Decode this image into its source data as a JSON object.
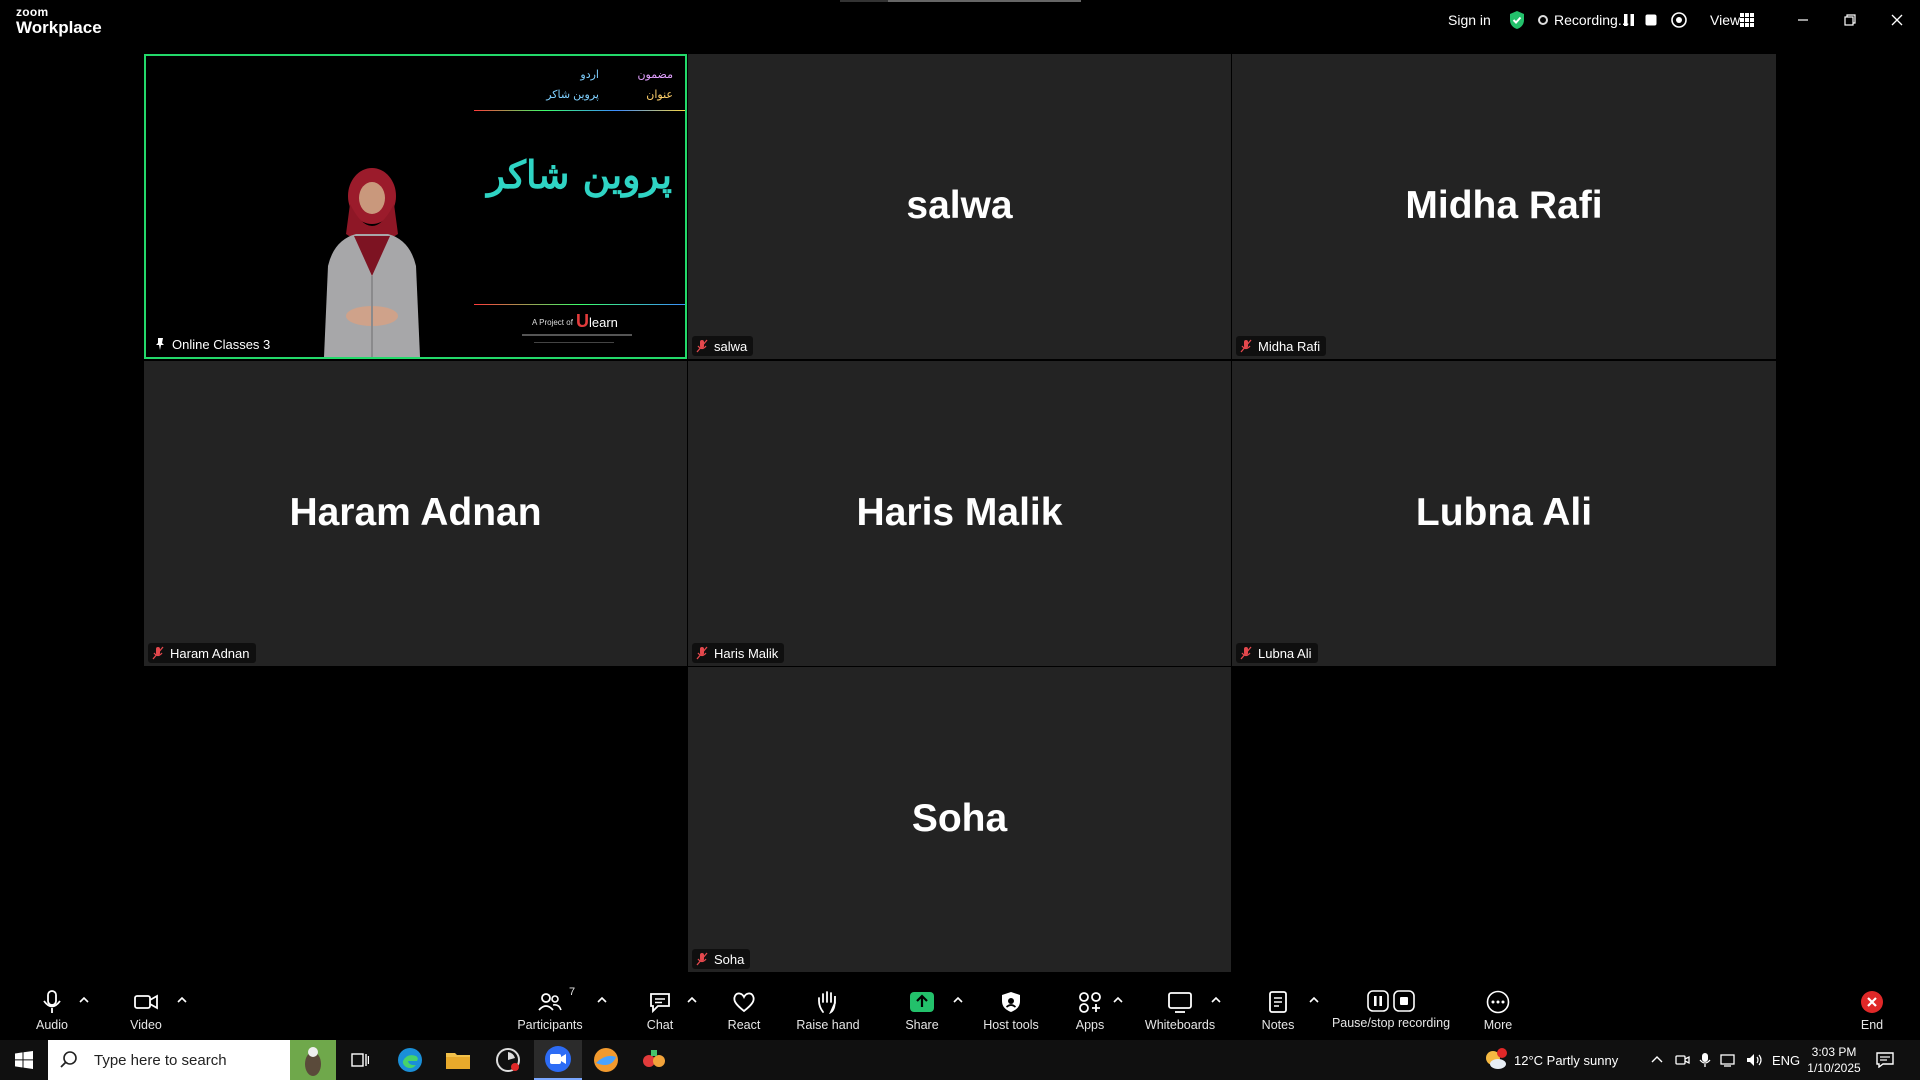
{
  "app": {
    "logo_line1": "zoom",
    "logo_line2": "Workplace"
  },
  "topbar": {
    "sign_in": "Sign in",
    "recording": "Recording...",
    "view": "View"
  },
  "gallery": {
    "tiles": [
      {
        "name": "Online Classes 3",
        "label": "Online Classes 3",
        "pinned": true,
        "active": true
      },
      {
        "name": "salwa",
        "label": "salwa",
        "muted": true
      },
      {
        "name": "Midha Rafi",
        "label": "Midha Rafi",
        "muted": true
      },
      {
        "name": "Haram Adnan",
        "label": "Haram Adnan",
        "muted": true
      },
      {
        "name": "Haris Malik",
        "label": "Haris Malik",
        "muted": true
      },
      {
        "name": "Lubna Ali",
        "label": "Lubna Ali",
        "muted": true
      },
      {
        "name": "Soha",
        "label": "Soha",
        "muted": true
      }
    ],
    "slide": {
      "subject_label": "مضمون",
      "subject_value": "اردو",
      "topic_label": "عنوان",
      "topic_value": "پروین شاکر",
      "title": "پروین شاکر",
      "project_of": "A Project of",
      "brand": "learn",
      "brand_u": "U"
    }
  },
  "toolbar": {
    "audio": "Audio",
    "video": "Video",
    "participants": "Participants",
    "participant_count": "7",
    "chat": "Chat",
    "react": "React",
    "raise_hand": "Raise hand",
    "share": "Share",
    "host_tools": "Host tools",
    "apps": "Apps",
    "whiteboards": "Whiteboards",
    "notes": "Notes",
    "pause_stop_recording": "Pause/stop recording",
    "more": "More",
    "end": "End"
  },
  "taskbar": {
    "search_placeholder": "Type here to search",
    "weather": "12°C  Partly sunny",
    "language": "ENG",
    "time": "3:03 PM",
    "date": "1/10/2025",
    "weather_badge": "1"
  },
  "colors": {
    "active_border": "#23d96a",
    "tile_bg": "#232323",
    "share_green": "#23c16b",
    "end_red": "#e02828",
    "mute_red": "#e5484d"
  }
}
